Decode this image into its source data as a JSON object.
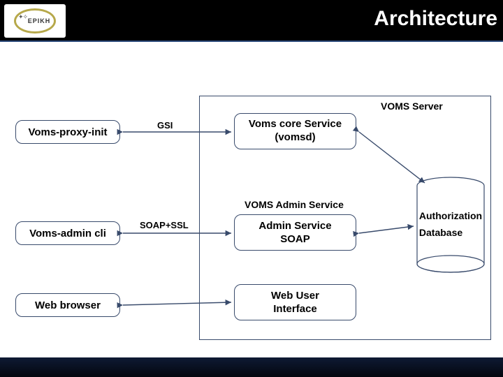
{
  "header": {
    "title": "Architecture",
    "logo_text": "EPIKH"
  },
  "server_label": "VOMS Server",
  "clients": {
    "proxy": "Voms-proxy-init",
    "admin_cli": "Voms-admin cli",
    "web_browser": "Web browser"
  },
  "services": {
    "core_line1": "Voms core Service",
    "core_line2": "(vomsd)",
    "admin_group": "VOMS Admin Service",
    "admin_line1": "Admin Service",
    "admin_line2": "SOAP",
    "webui_line1": "Web User",
    "webui_line2": "Interface"
  },
  "db": {
    "line1": "Authorization",
    "line2": "Database"
  },
  "edges": {
    "gsi": "GSI",
    "soap_ssl": "SOAP+SSL"
  }
}
